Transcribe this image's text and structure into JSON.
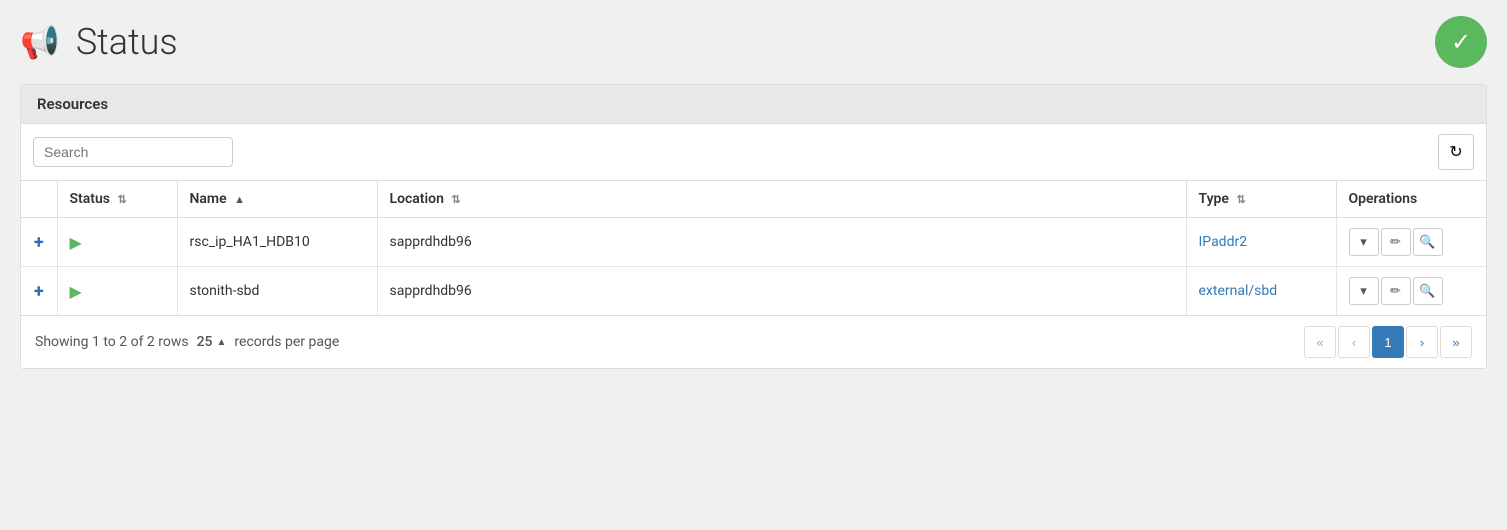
{
  "header": {
    "title": "Status",
    "check_label": "✓"
  },
  "resources_panel": {
    "section_label": "Resources"
  },
  "toolbar": {
    "search_placeholder": "Search",
    "refresh_icon": "↻"
  },
  "table": {
    "columns": [
      {
        "id": "checkbox",
        "label": ""
      },
      {
        "id": "status",
        "label": "Status",
        "sort": "both"
      },
      {
        "id": "name",
        "label": "Name",
        "sort": "up"
      },
      {
        "id": "location",
        "label": "Location",
        "sort": "both"
      },
      {
        "id": "type",
        "label": "Type",
        "sort": "both"
      },
      {
        "id": "operations",
        "label": "Operations"
      }
    ],
    "rows": [
      {
        "id": "row1",
        "add_icon": "+",
        "status_icon": "▶",
        "name": "rsc_ip_HA1_HDB10",
        "location": "sapprdhdb96",
        "type": "IPaddr2",
        "type_href": "#"
      },
      {
        "id": "row2",
        "add_icon": "+",
        "status_icon": "▶",
        "name": "stonith-sbd",
        "location": "sapprdhdb96",
        "type": "external/sbd",
        "type_href": "#"
      }
    ]
  },
  "footer": {
    "showing_text": "Showing 1 to 2 of 2 rows",
    "per_page_value": "25",
    "records_label": "records per page",
    "pagination": {
      "first": "«",
      "prev": "‹",
      "current": "1",
      "next": "›",
      "last": "»"
    }
  }
}
